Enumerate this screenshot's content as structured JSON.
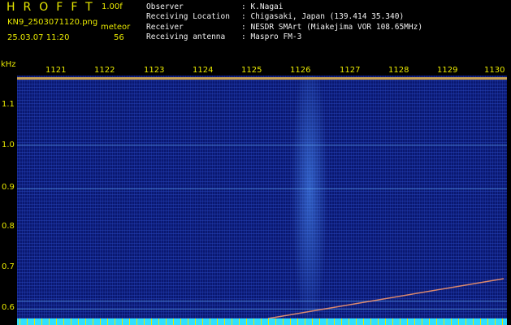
{
  "header": {
    "title": "HROFFT",
    "version": "1.00f",
    "filename": "KN9_2503071120.png",
    "meteor_label": "meteor",
    "datetime": "25.03.07 11:20",
    "meteor_count": "56"
  },
  "info": [
    {
      "key": "Observer",
      "value": ": K.Nagai"
    },
    {
      "key": "Receiving Location",
      "value": ": Chigasaki, Japan (139.414 35.340)"
    },
    {
      "key": "Receiver",
      "value": ": NESDR SMArt (Miakejima VOR 108.65MHz)"
    },
    {
      "key": "Receiving antenna",
      "value": ": Maspro FM-3"
    }
  ],
  "axis": {
    "unit": "kHz",
    "y_ticks": [
      "1.1",
      "1.0",
      "0.9",
      "0.8",
      "0.7",
      "0.6"
    ],
    "x_ticks": [
      "1121",
      "1122",
      "1123",
      "1124",
      "1125",
      "1126",
      "1127",
      "1128",
      "1129",
      "1130"
    ]
  },
  "colors": {
    "label": "#e8e800",
    "background": "#000000",
    "waterfall": "#0a1870"
  }
}
